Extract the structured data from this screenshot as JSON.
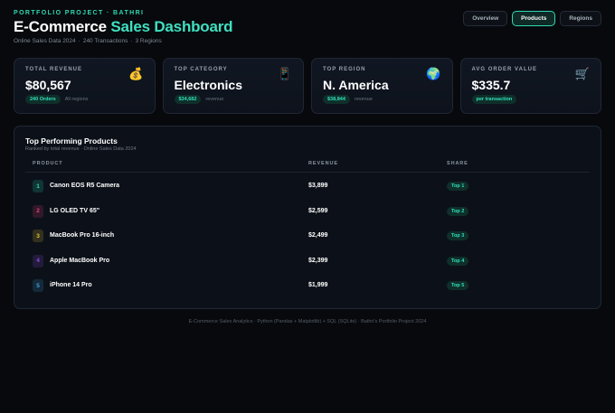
{
  "header": {
    "eyebrow": "PORTFOLIO PROJECT · BATHRI",
    "title_prefix": "E-Commerce ",
    "title_accent": "Sales Dashboard",
    "sub_dataset": "Online Sales Data 2024",
    "sub_transactions": "240 Transactions",
    "sub_regions": "3 Regions"
  },
  "nav": [
    {
      "label": "Overview"
    },
    {
      "label": "Products",
      "active": true
    },
    {
      "label": "Regions"
    }
  ],
  "cards": [
    {
      "label": "TOTAL REVENUE",
      "value": "$80,567",
      "pill": "240 Orders",
      "note": "All regions",
      "icon": "money-bag-icon",
      "glyph": "💰"
    },
    {
      "label": "TOP CATEGORY",
      "value": "Electronics",
      "pill": "$34,682",
      "note": "revenue",
      "icon": "mobile-phone-icon",
      "glyph": "📱"
    },
    {
      "label": "TOP REGION",
      "value": "N. America",
      "pill": "$38,844",
      "note": "revenue",
      "icon": "globe-icon",
      "glyph": "🌍"
    },
    {
      "label": "AVG ORDER VALUE",
      "value": "$335.7",
      "pill": "per transaction",
      "note": "",
      "icon": "shopping-cart-icon",
      "glyph": "🛒"
    }
  ],
  "products_panel": {
    "title": "Top Performing Products",
    "subtitle": "Ranked by total revenue · Online Sales Data 2024",
    "columns": {
      "product": "PRODUCT",
      "revenue": "REVENUE",
      "share": "SHARE"
    },
    "rows": [
      {
        "rank": "1",
        "name": "Canon EOS R5 Camera",
        "revenue": "$3,899",
        "tag": "Top 1",
        "color": "#2fd8b3"
      },
      {
        "rank": "2",
        "name": "LG OLED TV 65\"",
        "revenue": "$2,599",
        "tag": "Top 2",
        "color": "#e0407a"
      },
      {
        "rank": "3",
        "name": "MacBook Pro 16-inch",
        "revenue": "$2,499",
        "tag": "Top 3",
        "color": "#e6c23a"
      },
      {
        "rank": "4",
        "name": "Apple MacBook Pro",
        "revenue": "$2,399",
        "tag": "Top 4",
        "color": "#8a4bd6"
      },
      {
        "rank": "5",
        "name": "iPhone 14 Pro",
        "revenue": "$1,999",
        "tag": "Top 5",
        "color": "#3fa0d8"
      }
    ]
  },
  "footer": "E-Commerce Sales Analytics · Python (Pandas + Matplotlib) + SQL (SQLite) · Bathri's Portfolio Project 2024",
  "colors": {
    "accent": "#2fd8b3",
    "background": "#07090d"
  }
}
